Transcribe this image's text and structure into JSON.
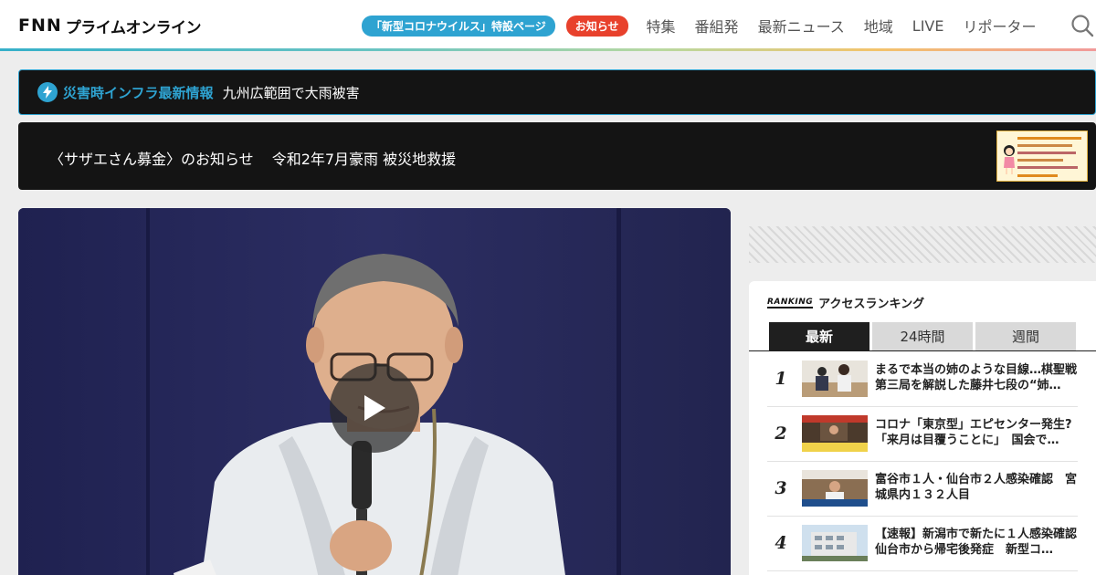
{
  "header": {
    "logo_fnn": "FNN",
    "logo_text": "プライムオンライン",
    "corona_pill": "「新型コロナウイルス」特設ページ",
    "notice_pill": "お知らせ",
    "nav": [
      "特集",
      "番組発",
      "最新ニュース",
      "地域",
      "LIVE",
      "リポーター"
    ]
  },
  "alert": {
    "title": "災害時インフラ最新情報",
    "text": "九州広範囲で大雨被害"
  },
  "promo": {
    "text_1": "〈サザエさん募金〉のお知らせ",
    "text_2": "令和2年7月豪雨 被災地救援"
  },
  "ranking": {
    "logo": "RANKING",
    "title": "アクセスランキング",
    "tabs": [
      "最新",
      "24時間",
      "週間"
    ],
    "items": [
      {
        "rank": "1",
        "title": "まるで本当の姉のような目線…棋聖戦第三局を解説した藤井七段の“姉…"
      },
      {
        "rank": "2",
        "title": "コロナ「東京型」エピセンター発生?「来月は目覆うことに」　国会で…"
      },
      {
        "rank": "3",
        "title": "富谷市１人・仙台市２人感染確認　宮城県内１３２人目"
      },
      {
        "rank": "4",
        "title": "【速報】新潟市で新たに１人感染確認　仙台市から帰宅後発症　新型コ…"
      }
    ]
  },
  "colors": {
    "accent_blue": "#2ea3d1",
    "notice_red": "#e8412c",
    "dark_panel": "#141414"
  }
}
